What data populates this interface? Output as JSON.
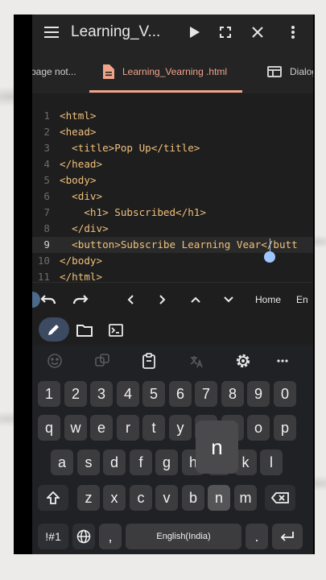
{
  "titlebar": {
    "title": "Learning_V..."
  },
  "tabs": [
    {
      "label": "page not..."
    },
    {
      "label": "Learning_Vearning .html"
    },
    {
      "label": "Dialog"
    }
  ],
  "editor": {
    "lines": [
      {
        "num": "1",
        "code": "<html>"
      },
      {
        "num": "2",
        "code": "<head>"
      },
      {
        "num": "3",
        "code": "  <title>Pop Up</title>"
      },
      {
        "num": "4",
        "code": "</head>"
      },
      {
        "num": "5",
        "code": "<body>"
      },
      {
        "num": "6",
        "code": "  <div>"
      },
      {
        "num": "7",
        "code": "    <h1> Subscribed</h1>"
      },
      {
        "num": "8",
        "code": "  </div>"
      },
      {
        "num": "9",
        "code": "  <button>Subscribe Learning Vear</butt"
      },
      {
        "num": "10",
        "code": "</body>"
      },
      {
        "num": "11",
        "code": "</html>"
      }
    ]
  },
  "navrow": {
    "home": "Home",
    "end": "En"
  },
  "keyboard": {
    "numbers": [
      "1",
      "2",
      "3",
      "4",
      "5",
      "6",
      "7",
      "8",
      "9",
      "0"
    ],
    "row1": [
      "q",
      "w",
      "e",
      "r",
      "t",
      "y",
      "u",
      "i",
      "o",
      "p"
    ],
    "row2": [
      "a",
      "s",
      "d",
      "f",
      "g",
      "h",
      "j",
      "k",
      "l"
    ],
    "row3": [
      "z",
      "x",
      "c",
      "v",
      "b",
      "n",
      "m"
    ],
    "symbols": "!#1",
    "comma": ",",
    "space": "English(India)",
    "period": ".",
    "popup": "n"
  }
}
